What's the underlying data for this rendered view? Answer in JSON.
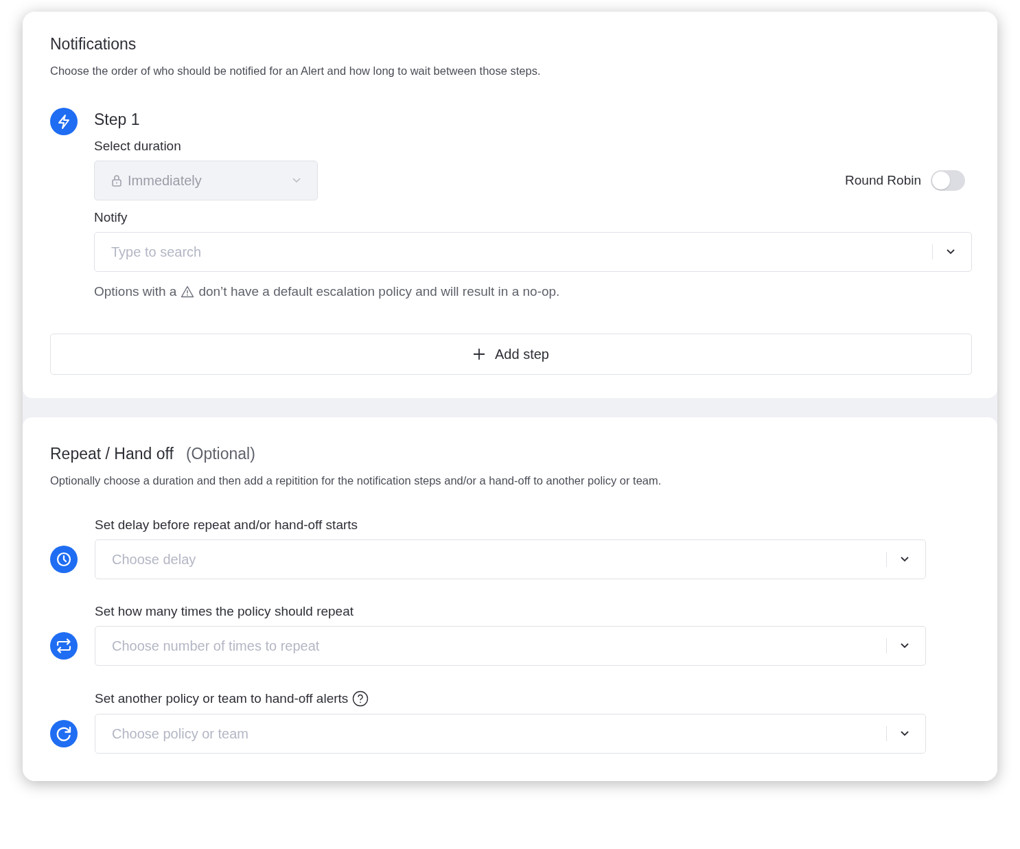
{
  "notifications": {
    "title": "Notifications",
    "description": "Choose the order of who should be notified for an Alert and how long to wait between those steps.",
    "steps": [
      {
        "title": "Step 1",
        "duration_label": "Select duration",
        "duration": {
          "value": "Immediately",
          "disabled": true
        },
        "round_robin": {
          "label": "Round Robin",
          "on": false
        },
        "notify_label": "Notify",
        "notify": {
          "placeholder": "Type to search"
        },
        "notice_before": "Options with a",
        "notice_after": "don’t have a default escalation policy and will result in a no-op."
      }
    ],
    "add_step": "Add step"
  },
  "repeat": {
    "title": "Repeat / Hand off",
    "optional": "(Optional)",
    "description": "Optionally choose a duration and then add a repitition for the notification steps and/or a hand-off to another policy or team.",
    "rows": [
      {
        "kind": "clock",
        "label": "Set delay before repeat and/or hand-off starts",
        "help": false,
        "placeholder": "Choose delay"
      },
      {
        "kind": "repeat",
        "label": "Set how many times the policy should repeat",
        "help": false,
        "placeholder": "Choose number of times to repeat"
      },
      {
        "kind": "refresh",
        "label": "Set another policy or team to hand-off alerts",
        "help": true,
        "placeholder": "Choose policy or team"
      }
    ]
  }
}
